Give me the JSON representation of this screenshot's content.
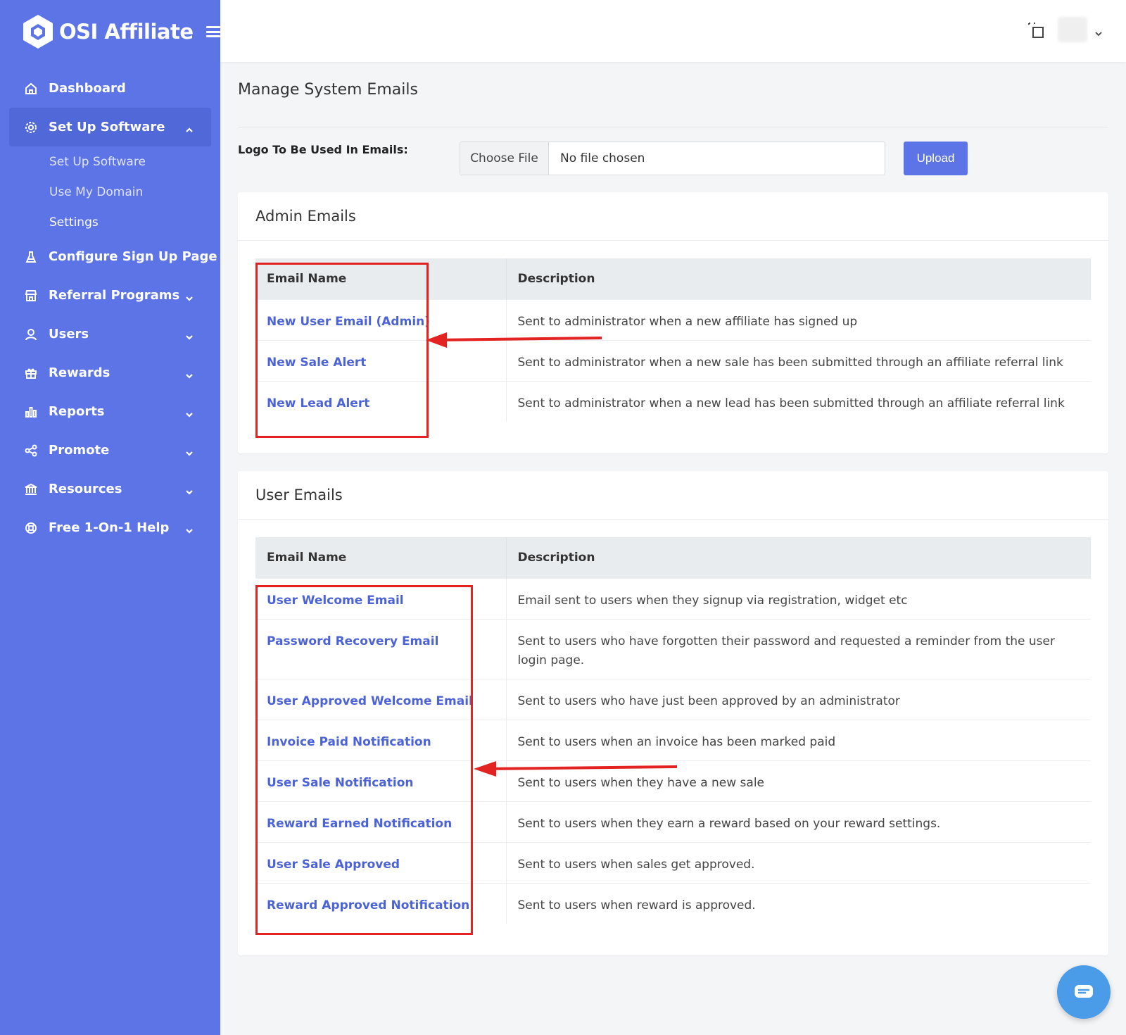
{
  "brand": {
    "name": "OSI Affiliate"
  },
  "sidebar": {
    "items": [
      {
        "label": "Dashboard",
        "icon": "home-icon"
      },
      {
        "label": "Set Up Software",
        "icon": "gear-icon"
      },
      {
        "label": "Configure Sign Up Page",
        "icon": "flask-icon"
      },
      {
        "label": "Referral Programs",
        "icon": "store-icon"
      },
      {
        "label": "Users",
        "icon": "user-icon"
      },
      {
        "label": "Rewards",
        "icon": "gift-icon"
      },
      {
        "label": "Reports",
        "icon": "bar-chart-icon"
      },
      {
        "label": "Promote",
        "icon": "share-icon"
      },
      {
        "label": "Resources",
        "icon": "bank-icon"
      },
      {
        "label": "Free 1-On-1 Help",
        "icon": "lifebuoy-icon"
      }
    ],
    "subitems": [
      {
        "label": "Set Up Software"
      },
      {
        "label": "Use My Domain"
      },
      {
        "label": "Settings"
      }
    ]
  },
  "page": {
    "title": "Manage System Emails"
  },
  "logo_upload": {
    "label": "Logo To Be Used In Emails:",
    "choose_label": "Choose File",
    "file_status": "No file chosen",
    "upload_label": "Upload"
  },
  "admin_emails": {
    "title": "Admin Emails",
    "col_name": "Email Name",
    "col_desc": "Description",
    "rows": [
      {
        "name": "New User Email (Admin)",
        "desc": "Sent to administrator when a new affiliate has signed up"
      },
      {
        "name": "New Sale Alert",
        "desc": "Sent to administrator when a new sale has been submitted through an affiliate referral link"
      },
      {
        "name": "New Lead Alert",
        "desc": "Sent to administrator when a new lead has been submitted through an affiliate referral link"
      }
    ]
  },
  "user_emails": {
    "title": "User Emails",
    "col_name": "Email Name",
    "col_desc": "Description",
    "rows": [
      {
        "name": "User Welcome Email",
        "desc": "Email sent to users when they signup via registration, widget etc"
      },
      {
        "name": "Password Recovery Email",
        "desc": "Sent to users who have forgotten their password and requested a reminder from the user login page."
      },
      {
        "name": "User Approved Welcome Email",
        "desc": "Sent to users who have just been approved by an administrator"
      },
      {
        "name": "Invoice Paid Notification",
        "desc": "Sent to users when an invoice has been marked paid"
      },
      {
        "name": "User Sale Notification",
        "desc": "Sent to users when they have a new sale"
      },
      {
        "name": "Reward Earned Notification",
        "desc": "Sent to users when they earn a reward based on your reward settings."
      },
      {
        "name": "User Sale Approved",
        "desc": "Sent to users when sales get approved."
      },
      {
        "name": "Reward Approved Notification",
        "desc": "Sent to users when reward is approved."
      }
    ]
  },
  "colors": {
    "sidebar": "#5c74e6",
    "link": "#4c63d8",
    "annotation": "#e32222",
    "chat": "#4a9be8"
  }
}
